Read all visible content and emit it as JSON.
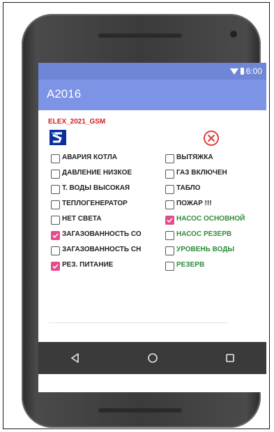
{
  "status_bar": {
    "time": "6:00"
  },
  "app": {
    "title": "A2016"
  },
  "header": {
    "brand": "ELEX_2021_GSM"
  },
  "alarms_left": [
    {
      "label": "АВАРИЯ КОТЛА",
      "checked": false,
      "color": "#222222"
    },
    {
      "label": "ДАВЛЕНИЕ НИЗКОЕ",
      "checked": false,
      "color": "#222222"
    },
    {
      "label": "Т. ВОДЫ ВЫСОКАЯ",
      "checked": false,
      "color": "#222222"
    },
    {
      "label": "ТЕПЛОГЕНЕРАТОР",
      "checked": false,
      "color": "#222222"
    },
    {
      "label": "НЕТ СВЕТА",
      "checked": false,
      "color": "#222222"
    },
    {
      "label": "ЗАГАЗОВАННОСТЬ СО",
      "checked": true,
      "color": "#222222"
    },
    {
      "label": "ЗАГАЗОВАННОСТЬ СН",
      "checked": false,
      "color": "#222222"
    },
    {
      "label": "РЕЗ. ПИТАНИЕ",
      "checked": true,
      "color": "#222222"
    }
  ],
  "alarms_right": [
    {
      "label": "ВЫТЯЖКА",
      "checked": false,
      "color": "#222222"
    },
    {
      "label": "ГАЗ ВКЛЮЧЕН",
      "checked": false,
      "color": "#222222"
    },
    {
      "label": "ТАБЛО",
      "checked": false,
      "color": "#222222"
    },
    {
      "label": "ПОЖАР !!!",
      "checked": false,
      "color": "#222222"
    },
    {
      "label": "НАСОС ОСНОВНОЙ",
      "checked": true,
      "color": "#2e8b3a"
    },
    {
      "label": "НАСОС РЕЗЕРВ",
      "checked": false,
      "color": "#2e8b3a"
    },
    {
      "label": "УРОВЕНЬ ВОДЫ",
      "checked": false,
      "color": "#2e8b3a"
    },
    {
      "label": "РЕЗЕРВ",
      "checked": false,
      "color": "#2e8b3a"
    }
  ],
  "icons": {
    "logo": "s-logo-icon",
    "stop": "stop-circle-icon",
    "nav_back": "back-triangle-icon",
    "nav_home": "home-circle-icon",
    "nav_recents": "recents-square-icon"
  },
  "colors": {
    "accent": "#7c93e6",
    "checked": "#e64b8b",
    "brand_red": "#d11f1f",
    "green_label": "#2e8b3a"
  }
}
